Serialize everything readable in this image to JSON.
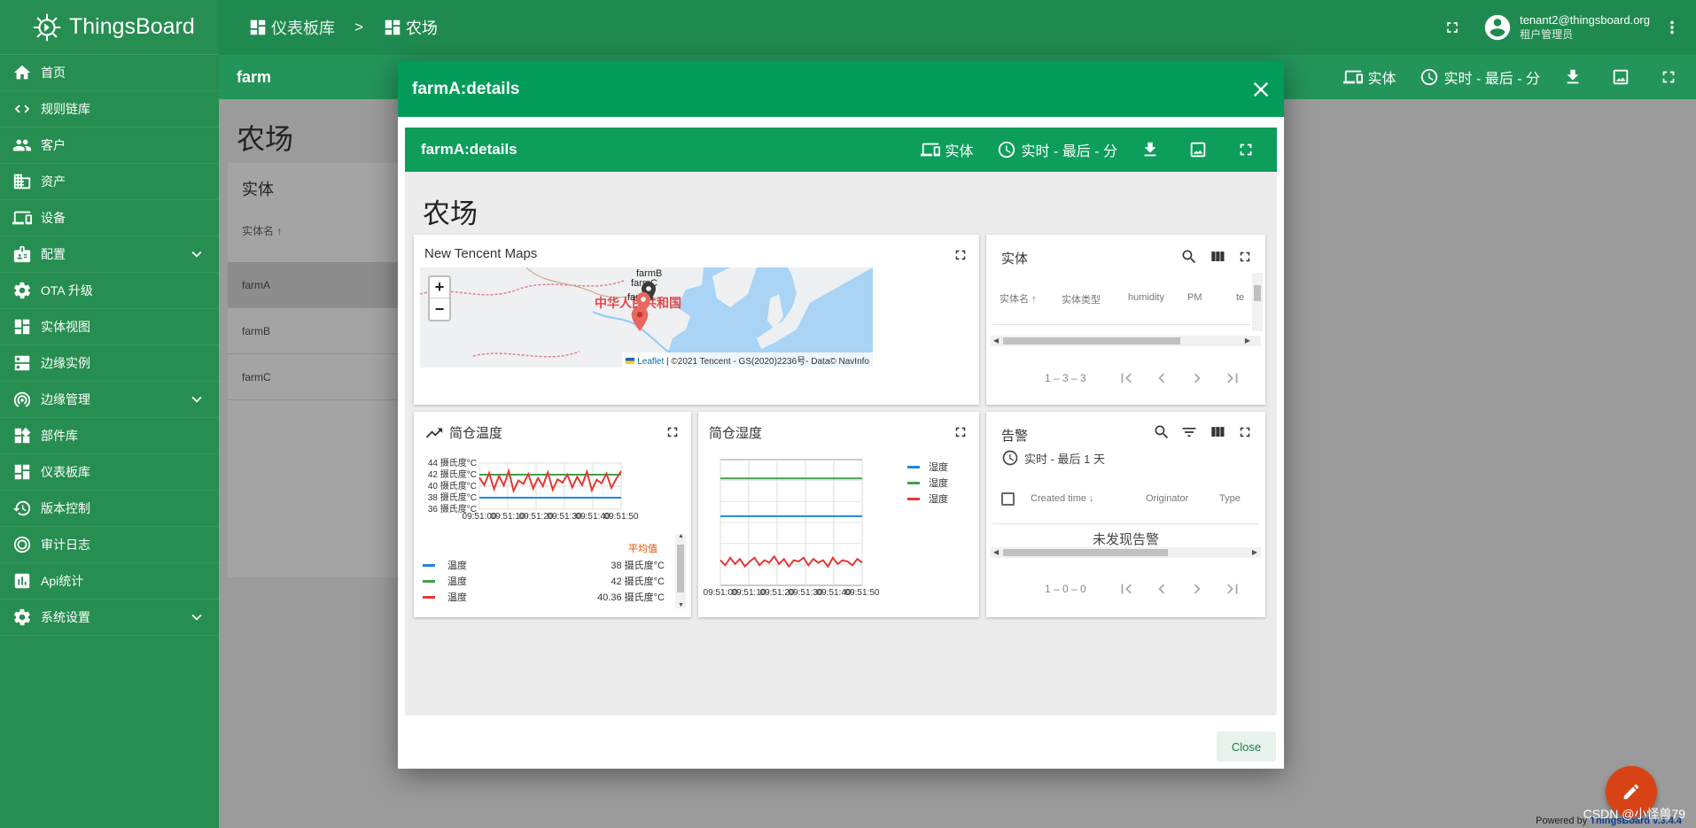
{
  "app": {
    "brand": "ThingsBoard"
  },
  "sidebar": {
    "items": [
      {
        "label": "首页",
        "icon": "home-icon"
      },
      {
        "label": "规则链库",
        "icon": "rule-chain-icon"
      },
      {
        "label": "客户",
        "icon": "customers-icon"
      },
      {
        "label": "资产",
        "icon": "assets-icon"
      },
      {
        "label": "设备",
        "icon": "devices-icon"
      },
      {
        "label": "配置",
        "icon": "profiles-icon",
        "expandable": true
      },
      {
        "label": "OTA 升级",
        "icon": "ota-icon"
      },
      {
        "label": "实体视图",
        "icon": "entity-view-icon"
      },
      {
        "label": "边缘实例",
        "icon": "edge-icon"
      },
      {
        "label": "边缘管理",
        "icon": "edge-management-icon",
        "expandable": true
      },
      {
        "label": "部件库",
        "icon": "widgets-icon"
      },
      {
        "label": "仪表板库",
        "icon": "dashboards-icon"
      },
      {
        "label": "版本控制",
        "icon": "version-control-icon"
      },
      {
        "label": "审计日志",
        "icon": "audit-log-icon"
      },
      {
        "label": "Api统计",
        "icon": "api-usage-icon"
      },
      {
        "label": "系统设置",
        "icon": "settings-icon",
        "expandable": true
      }
    ]
  },
  "header": {
    "breadcrumb": [
      {
        "label": "仪表板库"
      },
      {
        "label": "农场"
      }
    ],
    "separator": ">",
    "user_email": "tenant2@thingsboard.org",
    "user_role": "租户管理员"
  },
  "subbar": {
    "title": "farm",
    "entities_label": "实体",
    "time_label": "实时 - 最后 - 分"
  },
  "background": {
    "page_title": "农场",
    "card_title": "实体",
    "column_label": "实体名",
    "rows": [
      "farmA",
      "farmB",
      "farmC"
    ],
    "powered_by": "Powered by",
    "powered_brand": "ThingsBoard v.3.4.4",
    "watermark": "CSDN @小怪兽79"
  },
  "dialog": {
    "title": "farmA:details",
    "close_label": "Close",
    "dashboard": {
      "title": "farmA:details",
      "entities_label": "实体",
      "time_label": "实时 - 最后 - 分",
      "heading": "农场"
    },
    "map_widget": {
      "title": "New Tencent Maps",
      "zoom_in": "+",
      "zoom_out": "−",
      "country_label": "中华人民共和国",
      "markers": [
        "farmB",
        "farmC",
        "farmA"
      ],
      "attribution_link": "Leaflet",
      "attribution_text": "| ©2021 Tencent - GS(2020)2236号- Data© NavInfo"
    },
    "entity_table": {
      "title": "实体",
      "columns": [
        "实体名",
        "实体类型",
        "humidity",
        "PM",
        "te"
      ],
      "pagination": "1 – 3 – 3"
    },
    "temp_chart": {
      "title": "简仓温度",
      "legend_header": "平均值",
      "legend": [
        {
          "name": "温度",
          "value": "38 摄氏度°C",
          "color": "#1e88e5"
        },
        {
          "name": "温度",
          "value": "42 摄氏度°C",
          "color": "#43a047"
        },
        {
          "name": "温度",
          "value": "40.36 摄氏度°C",
          "color": "#e53935"
        }
      ]
    },
    "humidity_chart": {
      "title": "简仓湿度",
      "legend": [
        {
          "name": "湿度",
          "color": "#1e88e5"
        },
        {
          "name": "湿度",
          "color": "#43a047"
        },
        {
          "name": "湿度",
          "color": "#e53935"
        }
      ]
    },
    "alarm_table": {
      "title": "告警",
      "time_label": "实时 - 最后 1 天",
      "columns": [
        "Created time",
        "Originator",
        "Type"
      ],
      "empty_text": "未发现告警",
      "pagination": "1 – 0 – 0"
    }
  },
  "chart_data": [
    {
      "type": "line",
      "title": "简仓温度",
      "x": [
        "09:51:00",
        "09:51:10",
        "09:51:20",
        "09:51:30",
        "09:51:40",
        "09:51:50"
      ],
      "y_ticks": [
        "36 摄氏度°C",
        "38 摄氏度°C",
        "40 摄氏度°C",
        "42 摄氏度°C",
        "44 摄氏度°C"
      ],
      "ylim": [
        36,
        44
      ],
      "series": [
        {
          "name": "温度",
          "color": "#1e88e5",
          "values": [
            38,
            38,
            38,
            38,
            38,
            38,
            38,
            38,
            38,
            38,
            38,
            38,
            38,
            38,
            38,
            38,
            38,
            38,
            38,
            38,
            38,
            38,
            38,
            38,
            38,
            38,
            38,
            38,
            38,
            38
          ]
        },
        {
          "name": "温度",
          "color": "#43a047",
          "values": [
            42,
            42,
            42,
            42,
            42,
            42,
            42,
            42,
            42,
            42,
            42,
            42,
            42,
            42,
            42,
            42,
            42,
            42,
            42,
            42,
            42,
            42,
            42,
            42,
            42,
            42,
            42,
            42,
            42,
            42
          ]
        },
        {
          "name": "温度",
          "color": "#e53935",
          "values": [
            41.5,
            40.2,
            42.3,
            39.5,
            41.8,
            40.1,
            42.6,
            39.2,
            41.0,
            40.4,
            42.1,
            39.6,
            41.4,
            40.0,
            42.4,
            39.4,
            41.2,
            40.6,
            42.0,
            39.8,
            41.6,
            40.2,
            42.5,
            39.3,
            41.1,
            40.5,
            42.2,
            39.7,
            41.3,
            42.6
          ]
        }
      ]
    },
    {
      "type": "line",
      "title": "简仓湿度",
      "x": [
        "09:51:00",
        "09:51:10",
        "09:51:20",
        "09:51:30",
        "09:51:40",
        "09:51:50"
      ],
      "series": [
        {
          "name": "湿度",
          "color": "#1e88e5",
          "values": [
            55,
            55,
            55,
            55,
            55,
            55,
            55,
            55,
            55,
            55,
            55,
            55,
            55,
            55,
            55,
            55,
            55,
            55,
            55,
            55,
            55,
            55,
            55,
            55,
            55,
            55,
            55,
            55,
            55,
            55
          ]
        },
        {
          "name": "湿度",
          "color": "#43a047",
          "values": [
            85,
            85,
            85,
            85,
            85,
            85,
            85,
            85,
            85,
            85,
            85,
            85,
            85,
            85,
            85,
            85,
            85,
            85,
            85,
            85,
            85,
            85,
            85,
            85,
            85,
            85,
            85,
            85,
            85,
            85
          ]
        },
        {
          "name": "湿度",
          "color": "#e53935",
          "values": [
            20,
            16,
            22,
            17,
            21,
            15,
            19,
            22,
            16,
            20,
            18,
            23,
            17,
            21,
            15,
            20,
            19,
            22,
            16,
            21,
            18,
            20,
            15,
            22,
            17,
            20,
            19,
            16,
            21,
            18
          ]
        }
      ]
    }
  ]
}
